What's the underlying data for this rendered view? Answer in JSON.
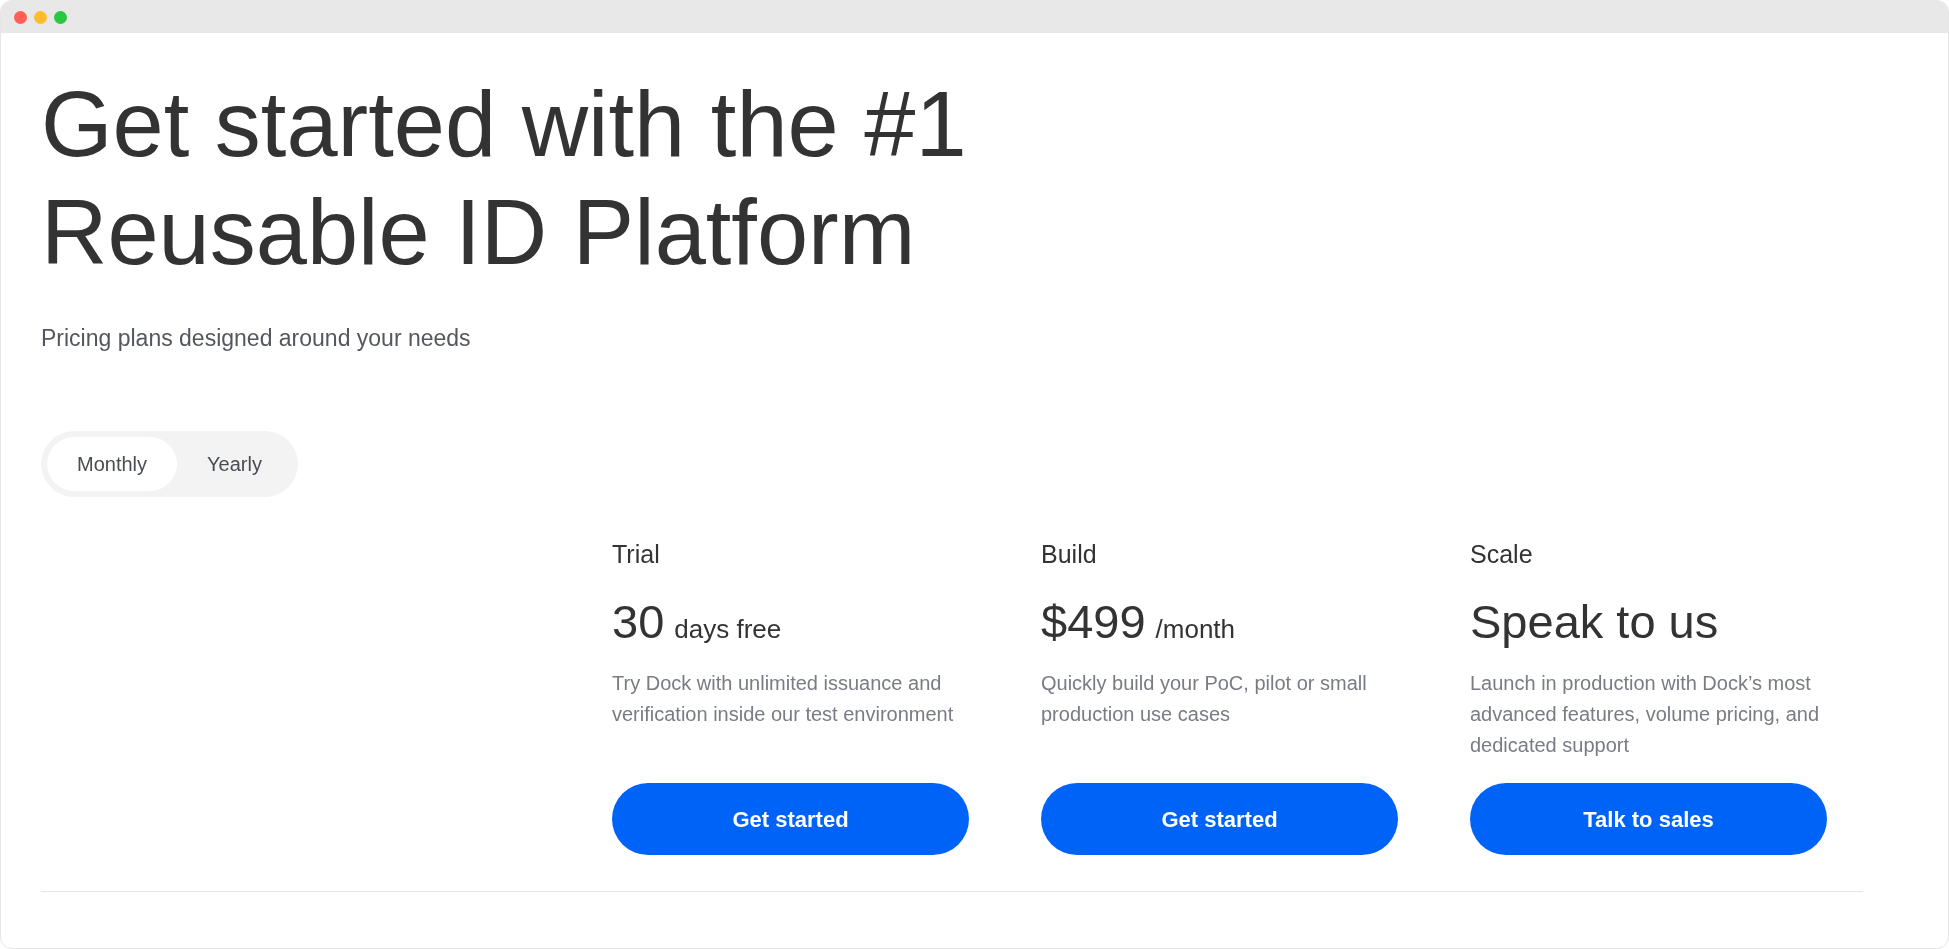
{
  "hero": {
    "title": "Get started with the #1 Reusable ID Platform",
    "subtitle": "Pricing plans designed around your needs"
  },
  "billing_toggle": [
    {
      "label": "Monthly",
      "selected": true
    },
    {
      "label": "Yearly",
      "selected": false
    }
  ],
  "plans": [
    {
      "name": "Trial",
      "price": "30",
      "price_suffix": "days free",
      "description": "Try Dock with unlimited issuance and verification inside our test environment",
      "button": "Get started"
    },
    {
      "name": "Build",
      "price": "$499",
      "price_suffix": "/month",
      "description": "Quickly build your PoC, pilot or small production use cases",
      "button": "Get started"
    },
    {
      "name": "Scale",
      "price": "Speak to us",
      "description": "Launch in production with Dock’s most advanced features, volume pricing, and dedicated support",
      "button": "Talk to sales"
    }
  ]
}
